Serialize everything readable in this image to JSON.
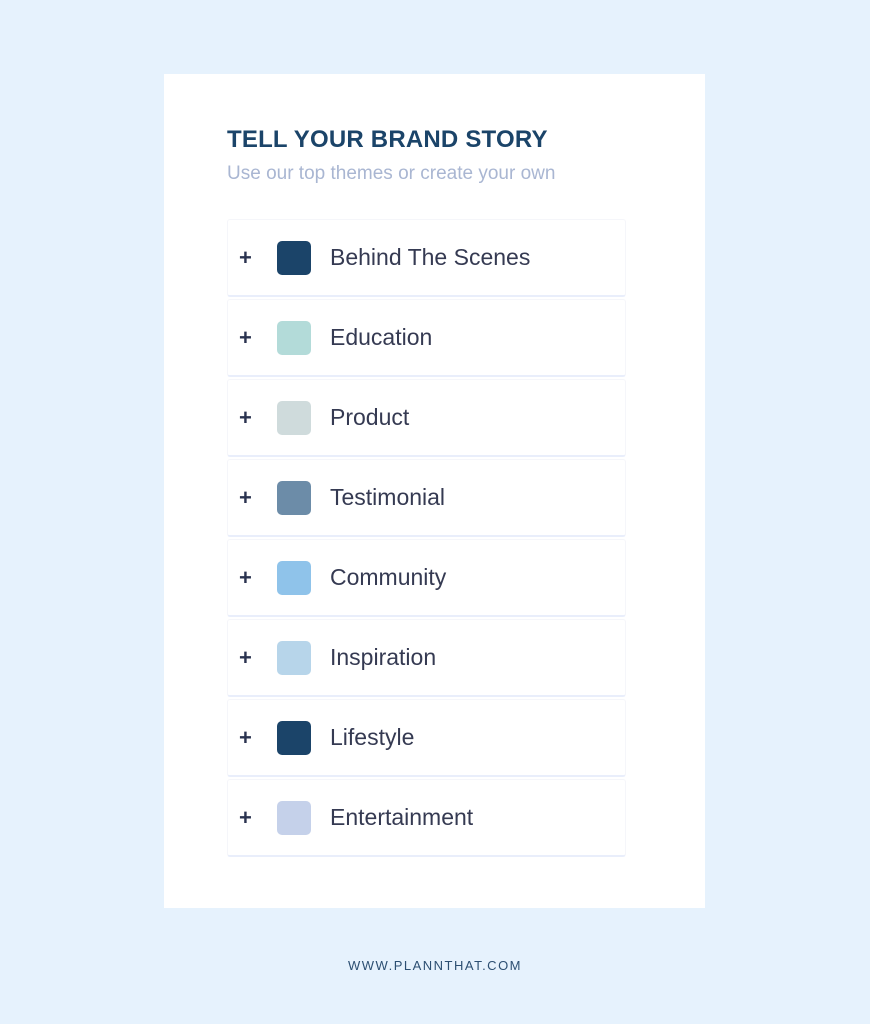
{
  "card": {
    "title": "TELL YOUR BRAND STORY",
    "subtitle": "Use our top themes or create your own"
  },
  "themes": [
    {
      "label": "Behind The Scenes",
      "color": "#1b4469",
      "icon": "plus-icon"
    },
    {
      "label": "Education",
      "color": "#b3dbd9",
      "icon": "plus-icon"
    },
    {
      "label": "Product",
      "color": "#cfdbdc",
      "icon": "plus-icon"
    },
    {
      "label": "Testimonial",
      "color": "#6c8ca8",
      "icon": "plus-icon"
    },
    {
      "label": "Community",
      "color": "#8fc3ea",
      "icon": "plus-icon"
    },
    {
      "label": "Inspiration",
      "color": "#b7d5ea",
      "icon": "plus-icon"
    },
    {
      "label": "Lifestyle",
      "color": "#1b4469",
      "icon": "plus-icon"
    },
    {
      "label": "Entertainment",
      "color": "#c5d1ea",
      "icon": "plus-icon"
    }
  ],
  "plus_glyph": "+",
  "footer": "WWW.PLANNTHAT.COM"
}
